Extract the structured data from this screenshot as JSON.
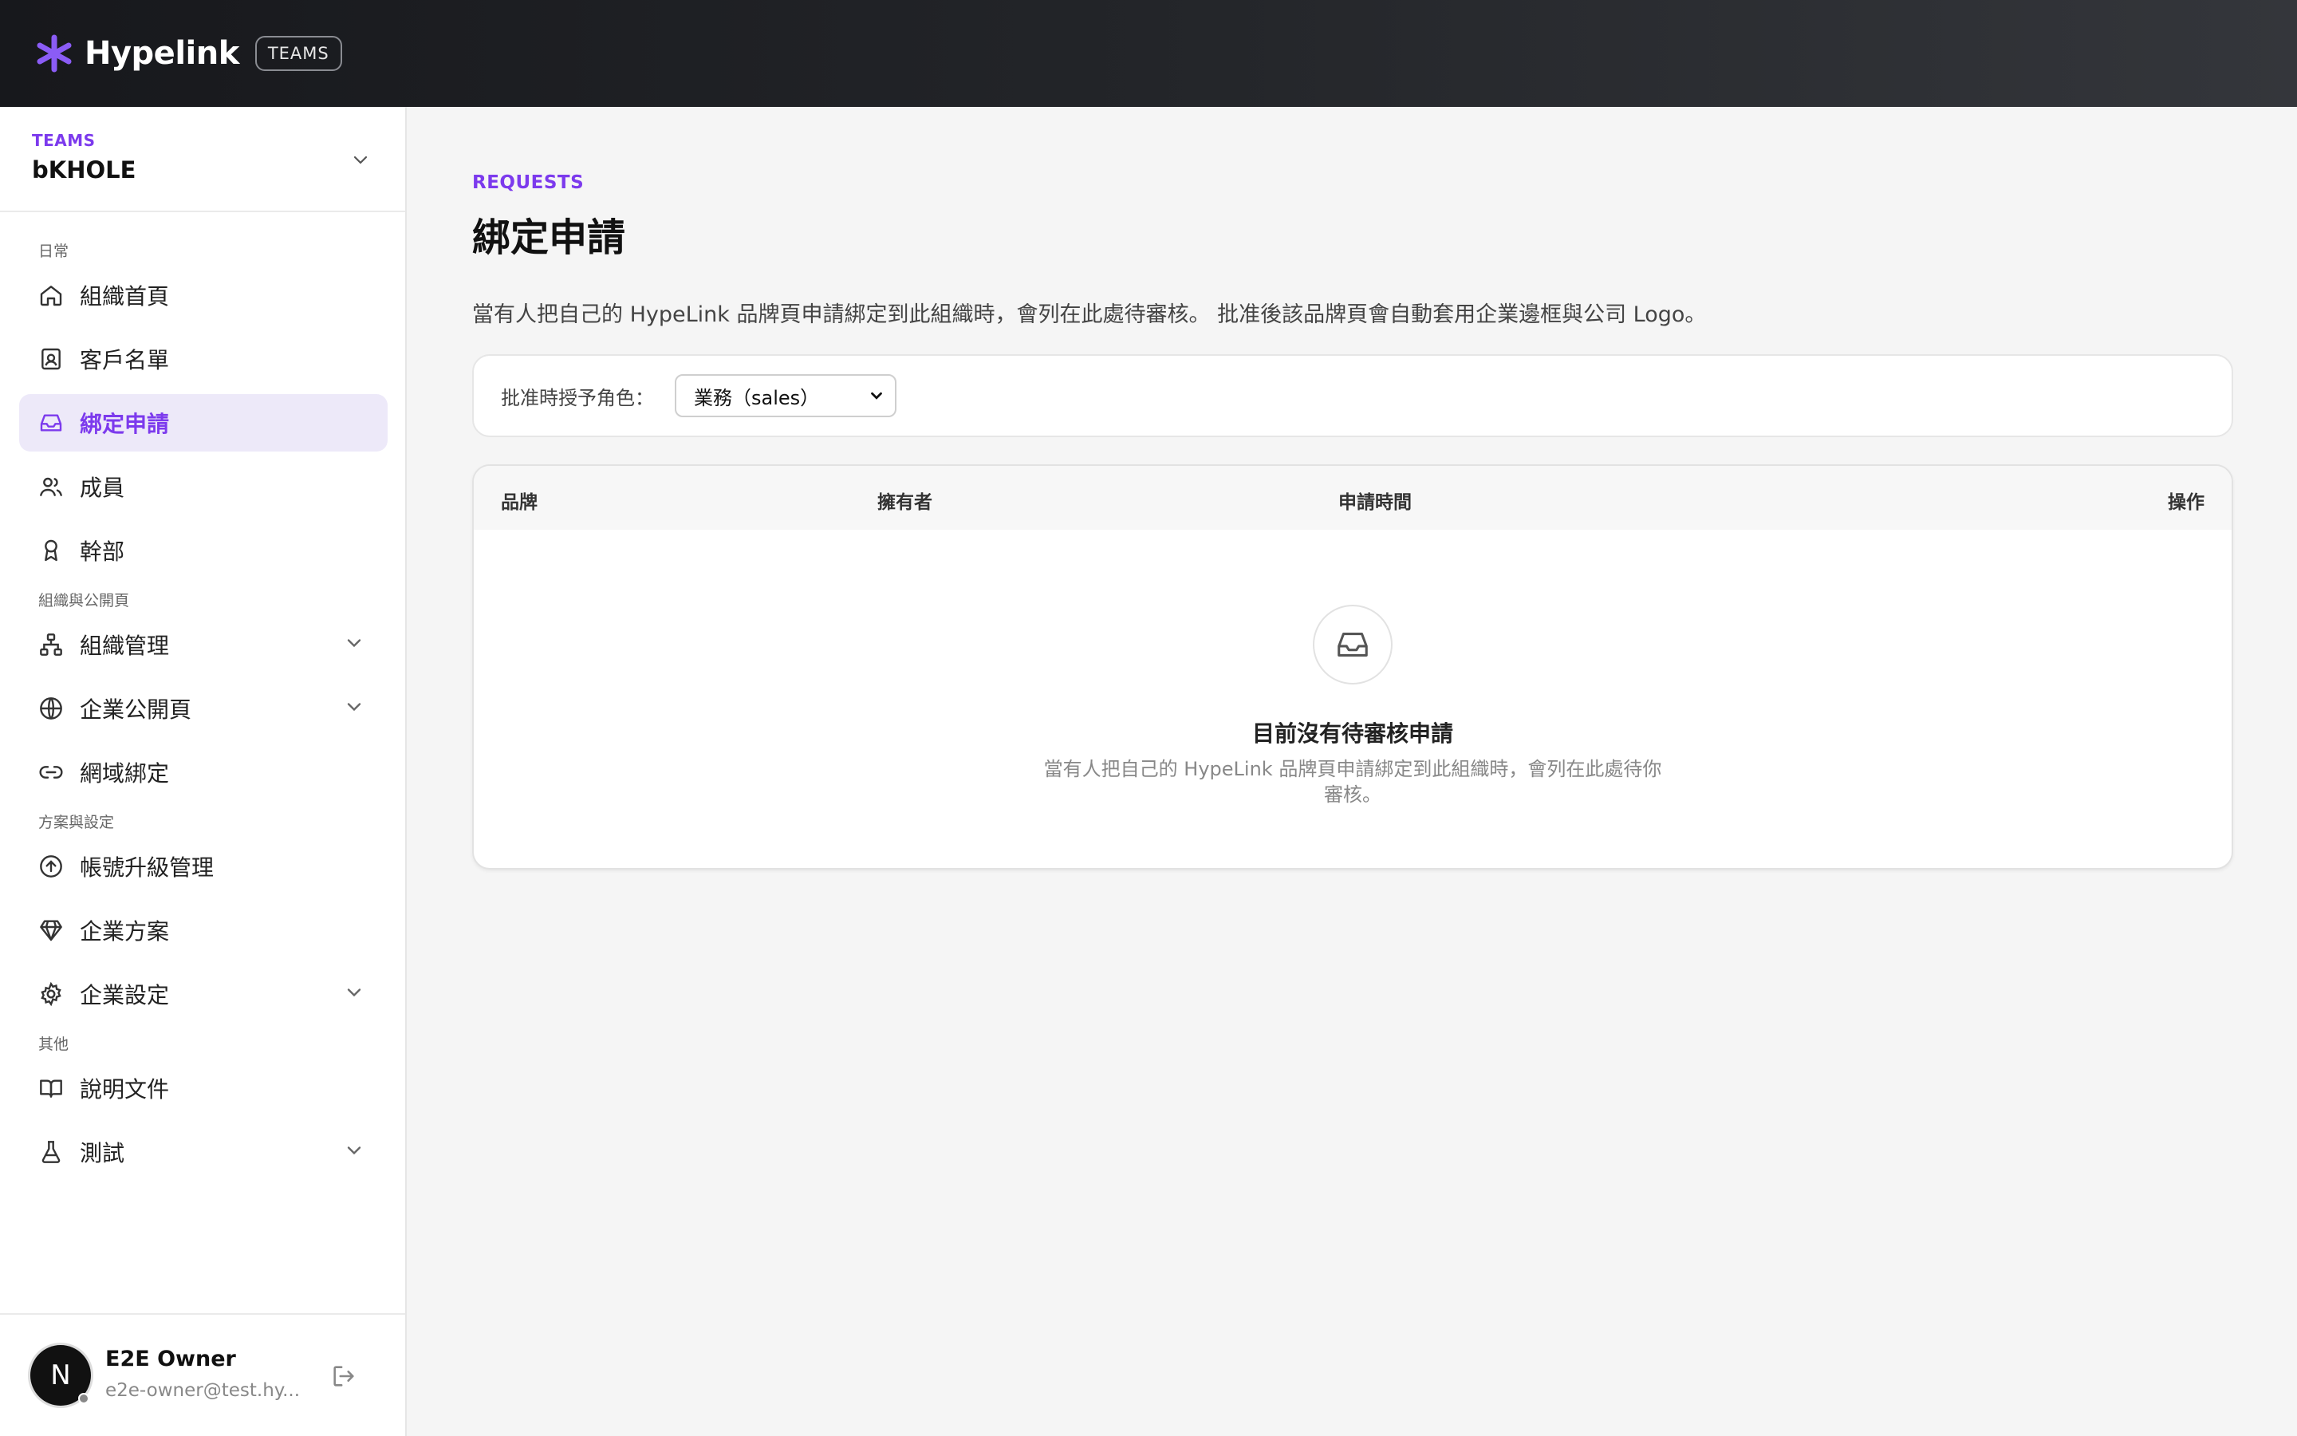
{
  "header": {
    "brand": "Hypelink",
    "badge": "TEAMS"
  },
  "sidebar": {
    "team_label": "TEAMS",
    "team_name": "bKHOLE",
    "sections": [
      "日常",
      "組織與公開頁",
      "方案與設定",
      "其他"
    ],
    "items": [
      {
        "label": "組織首頁",
        "icon": "home-icon"
      },
      {
        "label": "客戶名單",
        "icon": "contact-icon"
      },
      {
        "label": "綁定申請",
        "icon": "inbox-icon",
        "active": true
      },
      {
        "label": "成員",
        "icon": "users-icon"
      },
      {
        "label": "幹部",
        "icon": "award-icon"
      },
      {
        "label": "組織管理",
        "icon": "org-chart-icon",
        "expandable": true
      },
      {
        "label": "企業公開頁",
        "icon": "globe-icon",
        "expandable": true
      },
      {
        "label": "網域綁定",
        "icon": "link-icon"
      },
      {
        "label": "帳號升級管理",
        "icon": "arrow-up-circle-icon"
      },
      {
        "label": "企業方案",
        "icon": "gem-icon"
      },
      {
        "label": "企業設定",
        "icon": "gear-icon",
        "expandable": true
      },
      {
        "label": "說明文件",
        "icon": "book-icon"
      },
      {
        "label": "測試",
        "icon": "flask-icon",
        "expandable": true
      }
    ],
    "user": {
      "initial": "N",
      "name": "E2E Owner",
      "email": "e2e-owner@test.hy..."
    }
  },
  "main": {
    "eyebrow": "REQUESTS",
    "title": "綁定申請",
    "description": "當有人把自己的 HypeLink 品牌頁申請綁定到此組織時，會列在此處待審核。 批准後該品牌頁會自動套用企業邊框與公司 Logo。",
    "filter": {
      "label": "批准時授予角色：",
      "selected_role": "業務（sales）"
    },
    "table": {
      "columns": [
        "品牌",
        "擁有者",
        "申請時間",
        "操作"
      ],
      "empty_title": "目前沒有待審核申請",
      "empty_desc": "當有人把自己的 HypeLink 品牌頁申請綁定到此組織時，會列在此處待你審核。"
    }
  },
  "colors": {
    "accent": "#7c3aed",
    "active_bg": "#ede9f9",
    "topbar": "#17181c"
  }
}
